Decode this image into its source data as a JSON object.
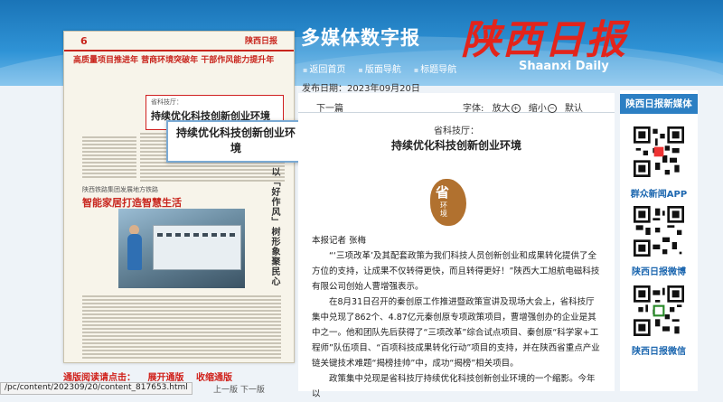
{
  "header": {
    "site_title": "多媒体数字报",
    "brand": "陕西日报",
    "brand_en": "Shaanxi Daily",
    "nav": [
      "返回首页",
      "版面导航",
      "标题导航"
    ]
  },
  "page_view": {
    "page_number": "6",
    "headline_strip": "高质量项目推进年  营商环境突破年  干部作风能力提升年",
    "paper_logo": "陕西日报",
    "article_kicker": "省科技厅：",
    "article_title": "持续优化科技创新创业环境",
    "vertical_headline_1": "以「好作风」树形象聚民心",
    "vertical_headline_2": "营商环境",
    "section2_kicker": "陕西铁路集团发展地方铁路",
    "section2_title": "智能家居打造智慧生活"
  },
  "popup": {
    "title": "持续优化科技创新创业环境"
  },
  "reader": {
    "label": "通版阅读请点击：",
    "expand": "展开通版",
    "collapse": "收缩通版"
  },
  "status_bar": {
    "url": "/pc/content/202309/20/content_817653.html",
    "page_nav": "上一版  下一版"
  },
  "article": {
    "pubdate": "发布日期：2023年09月20日",
    "prev_next": "下一篇",
    "font_label": "字体:",
    "font_larger": "放大",
    "font_smaller": "缩小",
    "font_default": "默认",
    "kicker": "省科技厅：",
    "title": "持续优化科技创新创业环境",
    "seal_char": "省",
    "seal_sub": "环境",
    "byline": "本报记者  张梅",
    "paragraphs": [
      "“‘三项改革’及其配套政策为我们科技人员创新创业和成果转化提供了全方位的支持，让成果不仅转得更快，而且转得更好！”陕西大工旭航电磁科技有限公司创始人曹增强表示。",
      "在8月31日召开的秦创原工作推进暨政策宣讲及现场大会上，省科技厅集中兑现了862个、4.87亿元秦创原专项政策项目，曹增强创办的企业是其中之一。他和团队先后获得了“三项改革”综合试点项目、秦创原“科学家+工程师”队伍项目、“百项科技成果转化行动”项目的支持，并在陕西省重点产业链关键技术难题“揭榜挂帅”中，成功“揭榜”相关项目。",
      "政策集中兑现是省科技厅持续优化科技创新创业环境的一个缩影。今年以"
    ]
  },
  "sidebar": {
    "header": "陕西日报新媒体",
    "items": [
      {
        "label": "群众新闻APP",
        "icon": "qr-code-icon"
      },
      {
        "label": "陕西日报微博",
        "icon": "qr-code-icon"
      },
      {
        "label": "陕西日报微信",
        "icon": "qr-code-icon"
      }
    ]
  },
  "colors": {
    "accent_red": "#c8251d",
    "banner_blue": "#1a74b7",
    "sidebar_blue": "#2c7fc3"
  }
}
